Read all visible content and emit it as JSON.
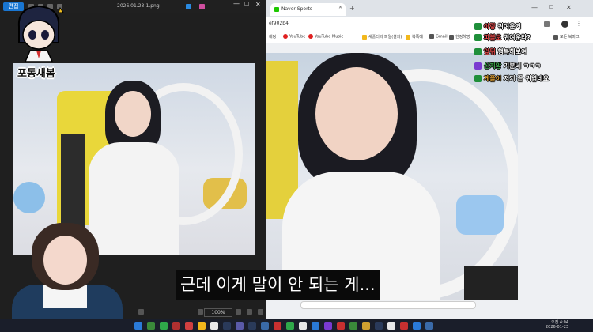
{
  "viewer": {
    "edit_label": "편집",
    "title": "2026.01.23-1.png",
    "zoom": "100%",
    "minimize_icon": "minimize-icon",
    "maximize_icon": "maximize-icon",
    "close_icon": "close-icon"
  },
  "browser": {
    "tab_title": "Naver Sports",
    "url": "ef902b4",
    "bookmarks": [
      "채팅",
      "YouTube",
      "YouTube Music",
      "새폴더의 파일(설치)",
      "북쪽에",
      "Gmail",
      "한정해명",
      "모든 북마크"
    ]
  },
  "chat": {
    "messages": [
      {
        "user": "아랑",
        "text": "귀여운거",
        "color": "#e24848"
      },
      {
        "user": "파블로",
        "text": "귀여운타?",
        "color": "#e24848"
      },
      {
        "user": "앞뒤",
        "text": "행복해보여",
        "color": "#e24848"
      },
      {
        "user": "신지앙",
        "text": "기분네 ㅋㅋㅋ",
        "color": "#3aa84a"
      },
      {
        "user": "게플이",
        "text": "저기 끝 귀엽네요",
        "color": "#e2a030"
      }
    ]
  },
  "logo": {
    "text": "포동새봄"
  },
  "subtitle": {
    "text": "근데 이게 말이 안 되는 게..."
  },
  "tray": {
    "time": "오전 4:04",
    "date": "2026-01-23"
  },
  "colors": {
    "accent": "#1976d2",
    "chat_badge": "#1f8f3a",
    "taskbar": "#1a1e2a"
  }
}
